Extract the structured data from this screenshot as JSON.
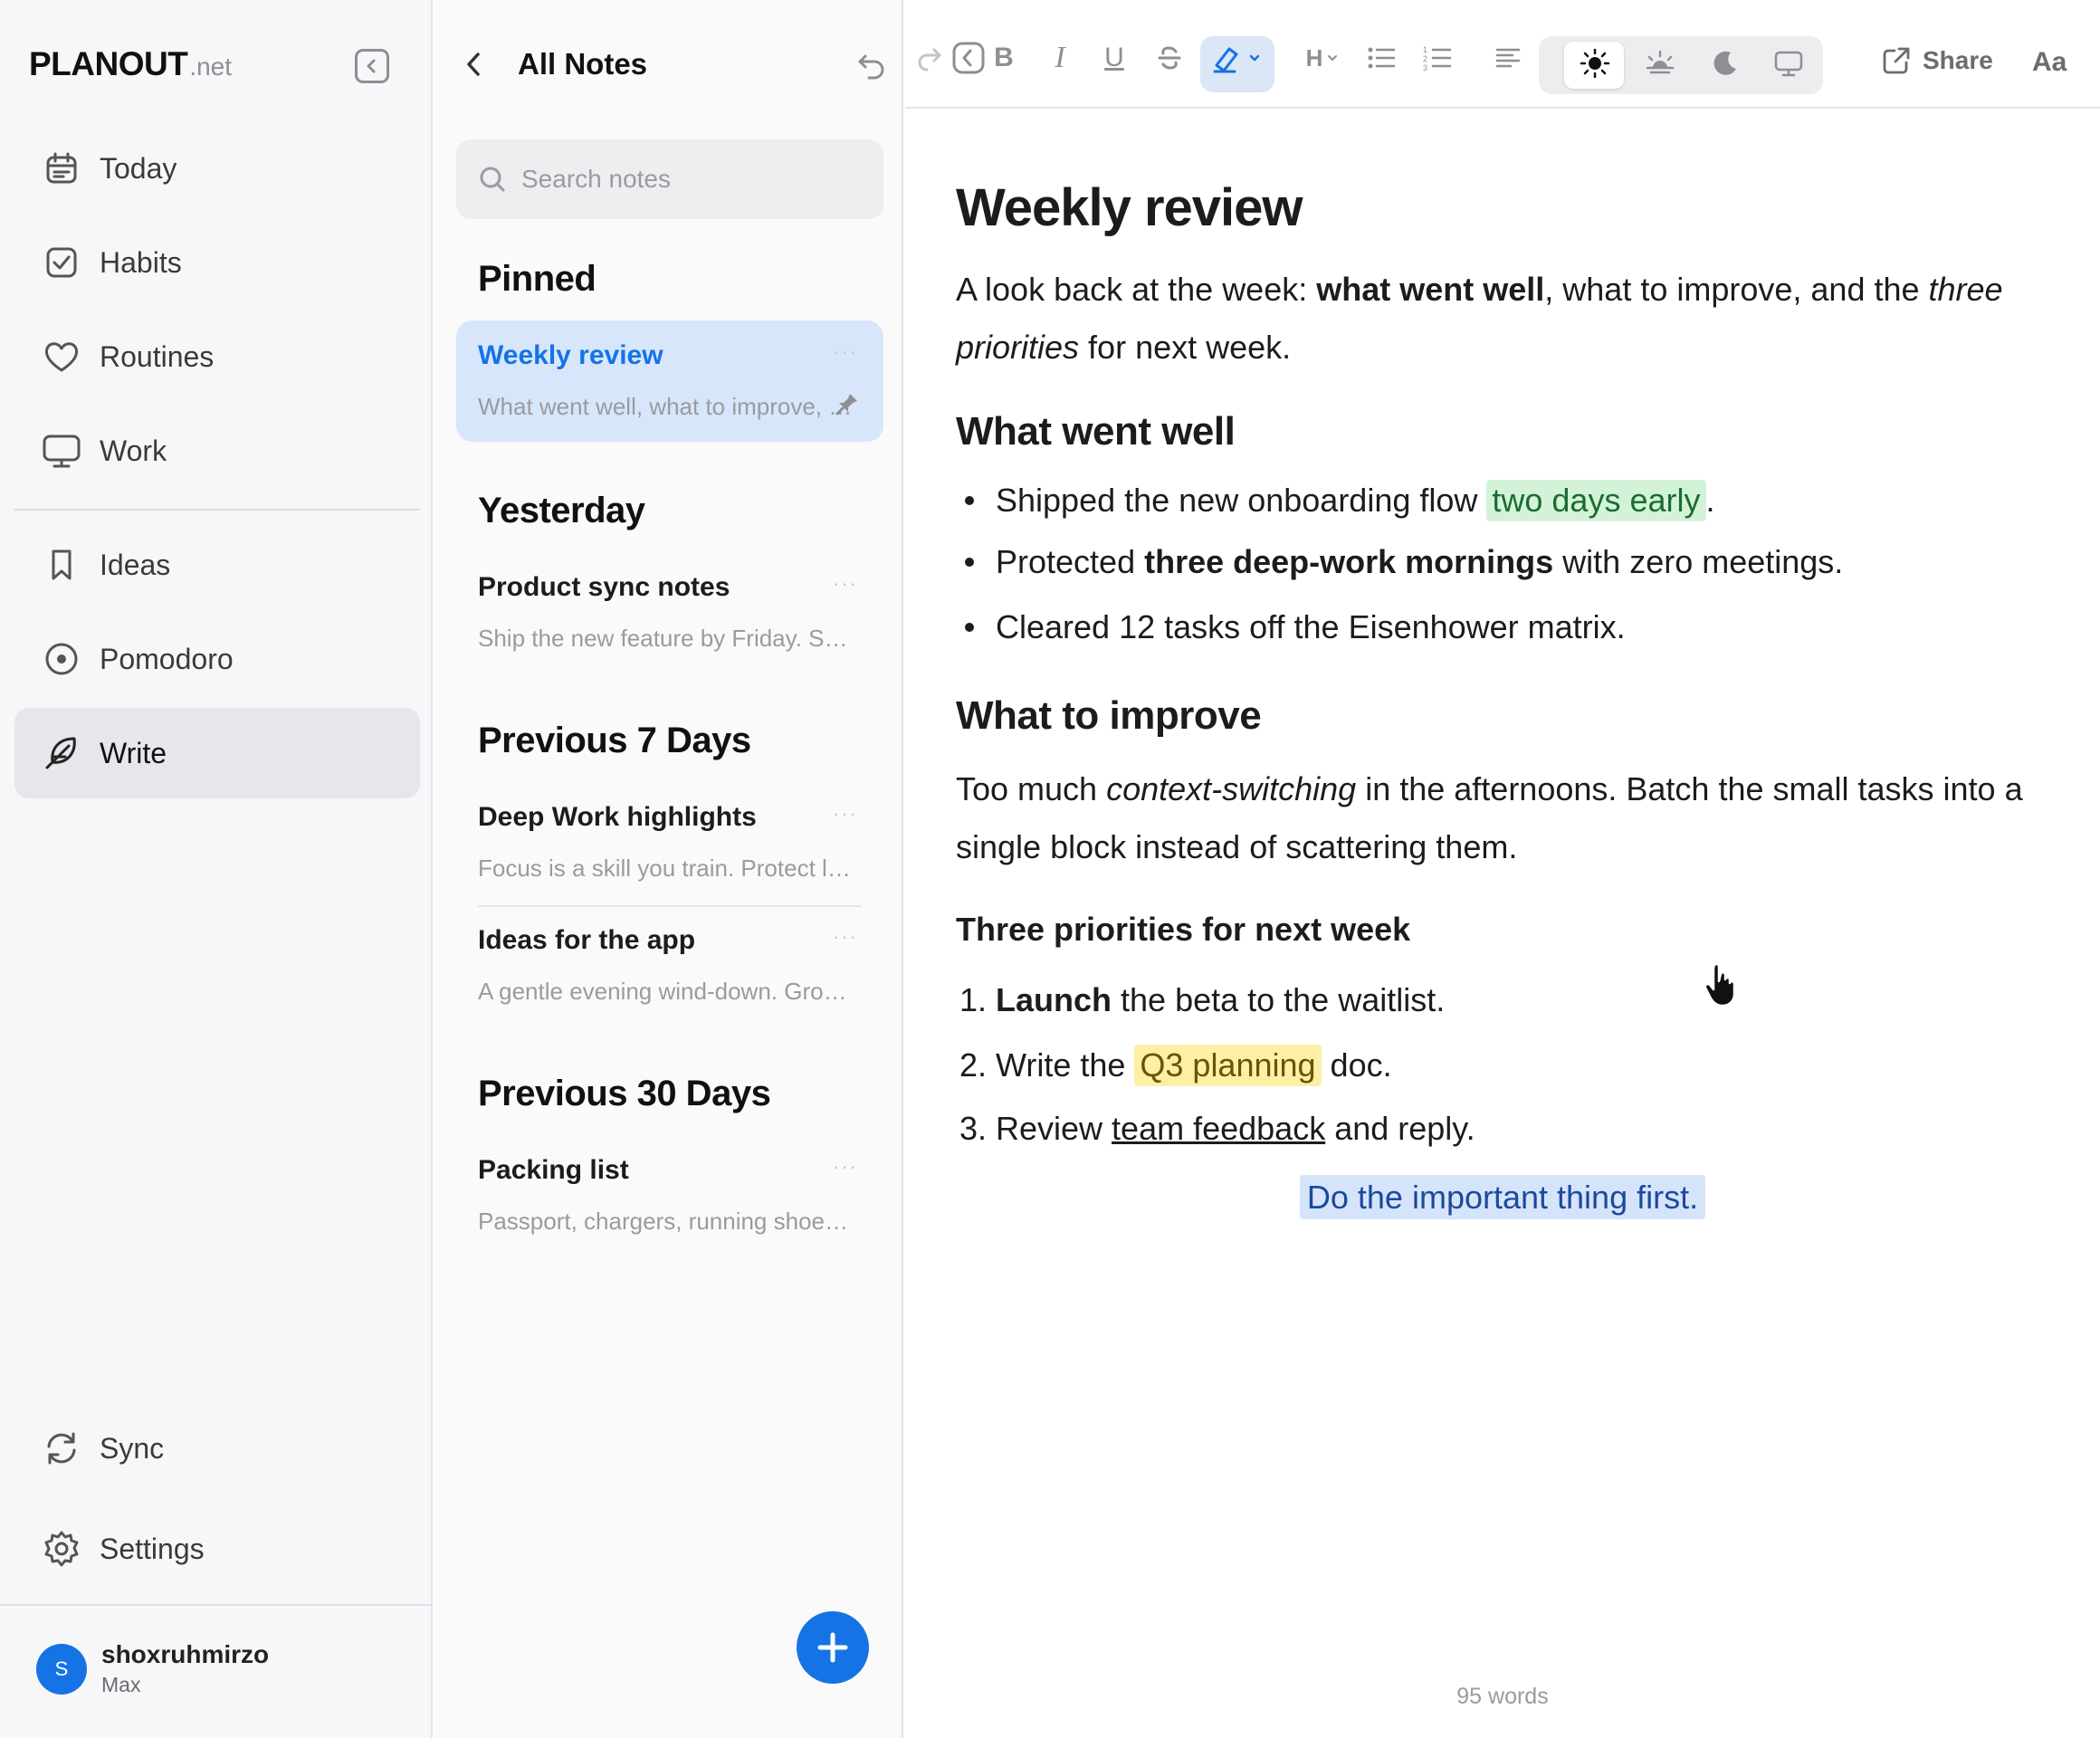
{
  "brand": {
    "name": "PLANOUT",
    "suffix": ".net"
  },
  "sidebar": {
    "items": [
      {
        "label": "Today"
      },
      {
        "label": "Habits"
      },
      {
        "label": "Routines"
      },
      {
        "label": "Work"
      },
      {
        "label": "Ideas"
      },
      {
        "label": "Pomodoro"
      },
      {
        "label": "Write"
      }
    ],
    "active": "Write",
    "bottom": [
      {
        "label": "Sync"
      },
      {
        "label": "Settings"
      }
    ],
    "user": {
      "initial": "S",
      "name": "shoxruhmirzo",
      "plan": "Max"
    }
  },
  "notes": {
    "title": "All Notes",
    "search_placeholder": "Search notes",
    "groups": [
      {
        "title": "Pinned",
        "notes": [
          {
            "title": "Weekly review",
            "preview": "What went well, what to improve, and the three priorities",
            "active": true,
            "pinned": true
          }
        ]
      },
      {
        "title": "Yesterday",
        "notes": [
          {
            "title": "Product sync notes",
            "preview": "Ship the new feature by Friday. Sync with design"
          }
        ]
      },
      {
        "title": "Previous 7 Days",
        "notes": [
          {
            "title": "Deep Work highlights",
            "preview": "Focus is a skill you train. Protect long blocks"
          },
          {
            "title": "Ideas for the app",
            "preview": "A gentle evening wind-down. Grocery lists"
          }
        ]
      },
      {
        "title": "Previous 30 Days",
        "notes": [
          {
            "title": "Packing list",
            "preview": "Passport, chargers, running shoes, notebook"
          }
        ]
      }
    ],
    "more_glyph": "···"
  },
  "toolbar": {
    "bold": "B",
    "italic": "I",
    "underline": "U",
    "heading": "H",
    "share_label": "Share",
    "font_label": "Aa",
    "highlight_color": "#dbe6f7",
    "active_theme": "light"
  },
  "document": {
    "title": "Weekly review",
    "intro": {
      "before_bold": "A look back at the week: ",
      "bold": "what went well",
      "after_bold": ", what to improve, and the ",
      "italic": "three priorities",
      "tail": " for next week."
    },
    "section1": {
      "heading": "What went well",
      "bullets": [
        {
          "text": "Shipped the new onboarding flow ",
          "highlight": "two days early",
          "tail": "."
        },
        {
          "text": "Protected ",
          "bold": "three deep-work mornings",
          "tail": " with zero meetings."
        },
        {
          "text": "Cleared 12 tasks off the Eisenhower matrix."
        }
      ]
    },
    "section2": {
      "heading": "What to improve",
      "before_italic": "Too much ",
      "italic": "context-switching",
      "after_italic": " in the afternoons. Batch the small tasks into a single block instead of scattering them."
    },
    "section3": {
      "heading": "Three priorities for next week",
      "items": [
        {
          "num": "1.",
          "bold": "Launch",
          "tail": " the beta to the waitlist."
        },
        {
          "num": "2.",
          "text": "Write the ",
          "highlight": "Q3 planning",
          "tail": " doc."
        },
        {
          "num": "3.",
          "text": "Review ",
          "underline": "team feedback",
          "tail": " and reply."
        }
      ]
    },
    "quote": "Do the important thing first.",
    "word_count": "95 words"
  },
  "colors": {
    "accent": "#1573e6",
    "green_highlight": "#d3f3d9",
    "yellow_highlight": "#fdefa6",
    "blue_highlight": "#d6e4fb"
  }
}
